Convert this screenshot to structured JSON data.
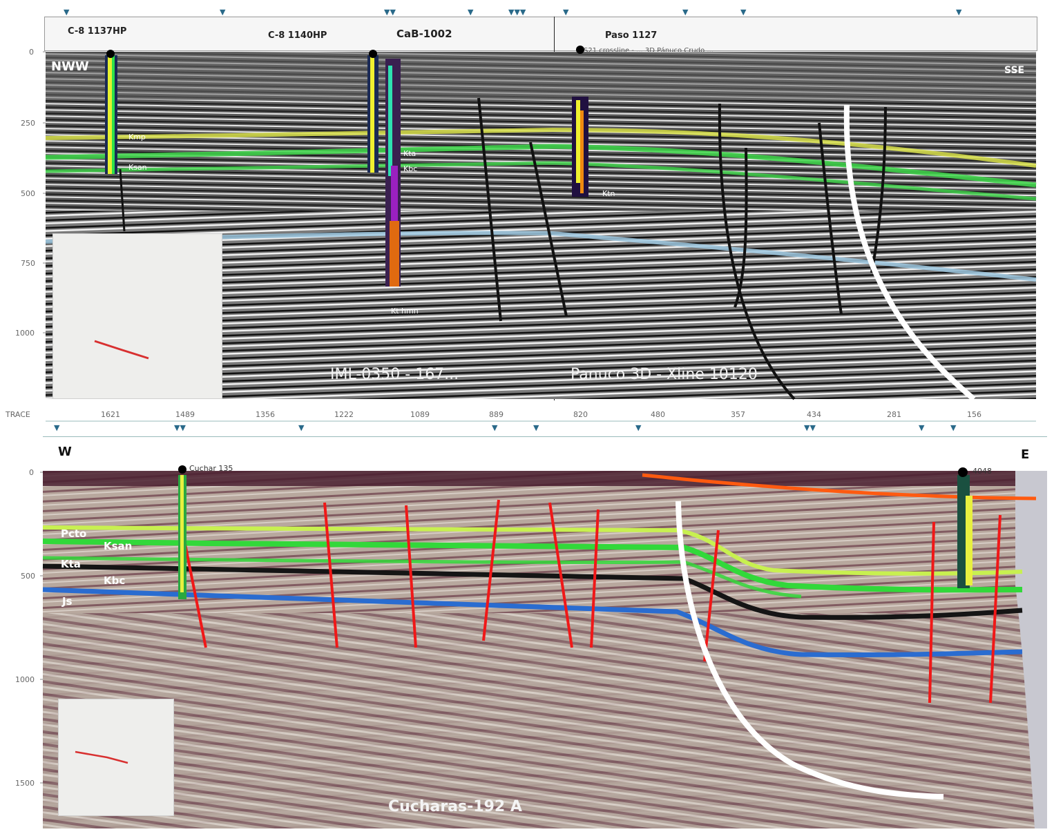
{
  "top_panel": {
    "well_headers": [
      "C-8 1137HP",
      "C-8 1140HP",
      "CaB-1002",
      "Paso 1127"
    ],
    "subtitle": "CS21 crossline - ... 3D Pánuco Crudo ...",
    "direction_left": "NWW",
    "direction_right": "SSE",
    "line_left": "IML-0350 - 167...",
    "line_right": "Panuco 3D - Xline 10120",
    "y_ticks": [
      "0",
      "250",
      "500",
      "750",
      "1000"
    ],
    "x_axis_label": "TRACE",
    "x_ticks": [
      "1621",
      "1489",
      "1356",
      "1222",
      "1089",
      "889",
      "820",
      "480",
      "357",
      "434",
      "281",
      "156"
    ],
    "horizon_labels": [
      "Kmp",
      "Ksan",
      "Kta",
      "Kbc",
      "Ktn",
      "Kt hmn"
    ],
    "colors": {
      "yellow_horizon": "#d8e04a",
      "green_horizon": "#3ed84a",
      "blue_horizon": "#9ec8e0",
      "fault": "#111111",
      "main_fault": "#ffffff"
    }
  },
  "bottom_panel": {
    "direction_left": "W",
    "direction_right": "E",
    "well_left": "Cuchar 135",
    "well_right": "4048",
    "y_ticks": [
      "0",
      "500",
      "1000",
      "1500"
    ],
    "line_label": "Cucharas-192 A",
    "horizon_labels": [
      "Pcto",
      "Ksan",
      "Kta",
      "Kbc",
      "Js"
    ],
    "colors": {
      "yellow_horizon": "#c8f050",
      "green_horizon": "#32d83a",
      "dark_horizon": "#151515",
      "blue_horizon": "#2a6cd0",
      "orange_horizon": "#ff5a10",
      "fault": "#f01818",
      "main_fault": "#ffffff"
    }
  }
}
